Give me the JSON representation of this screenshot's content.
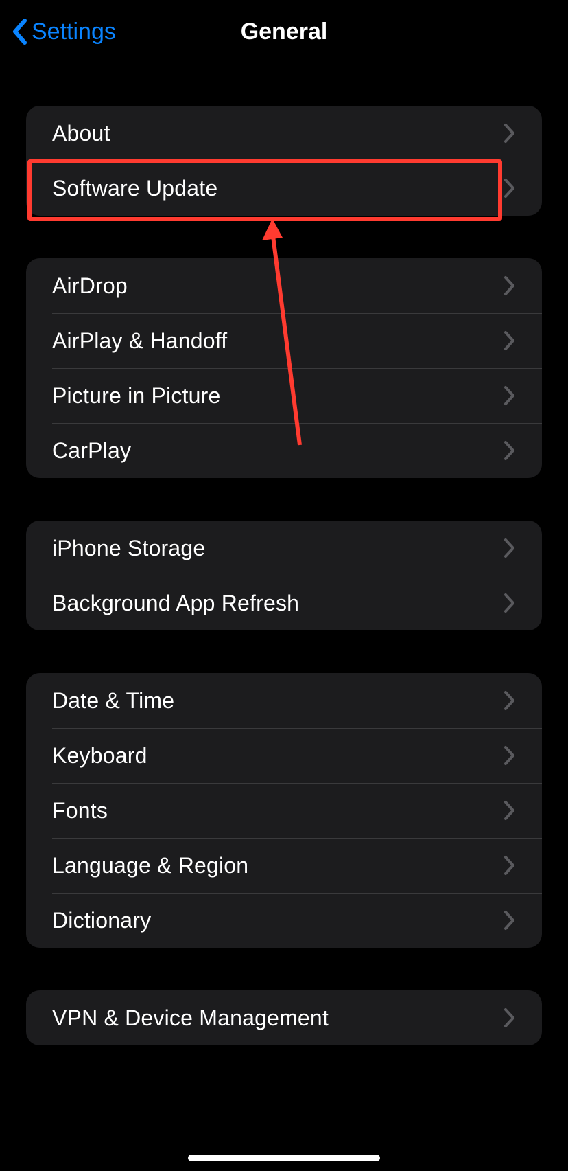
{
  "nav": {
    "back_label": "Settings",
    "title": "General"
  },
  "groups": [
    {
      "items": [
        {
          "id": "about",
          "label": "About"
        },
        {
          "id": "software-update",
          "label": "Software Update",
          "highlighted": true
        }
      ]
    },
    {
      "items": [
        {
          "id": "airdrop",
          "label": "AirDrop"
        },
        {
          "id": "airplay-handoff",
          "label": "AirPlay & Handoff"
        },
        {
          "id": "picture-in-picture",
          "label": "Picture in Picture"
        },
        {
          "id": "carplay",
          "label": "CarPlay"
        }
      ]
    },
    {
      "items": [
        {
          "id": "iphone-storage",
          "label": "iPhone Storage"
        },
        {
          "id": "background-app-refresh",
          "label": "Background App Refresh"
        }
      ]
    },
    {
      "items": [
        {
          "id": "date-time",
          "label": "Date & Time"
        },
        {
          "id": "keyboard",
          "label": "Keyboard"
        },
        {
          "id": "fonts",
          "label": "Fonts"
        },
        {
          "id": "language-region",
          "label": "Language & Region"
        },
        {
          "id": "dictionary",
          "label": "Dictionary"
        }
      ]
    },
    {
      "items": [
        {
          "id": "vpn-device-management",
          "label": "VPN & Device Management"
        }
      ]
    }
  ],
  "annotation": {
    "highlight_color": "#ff3b30",
    "arrow_color": "#ff3b30"
  }
}
